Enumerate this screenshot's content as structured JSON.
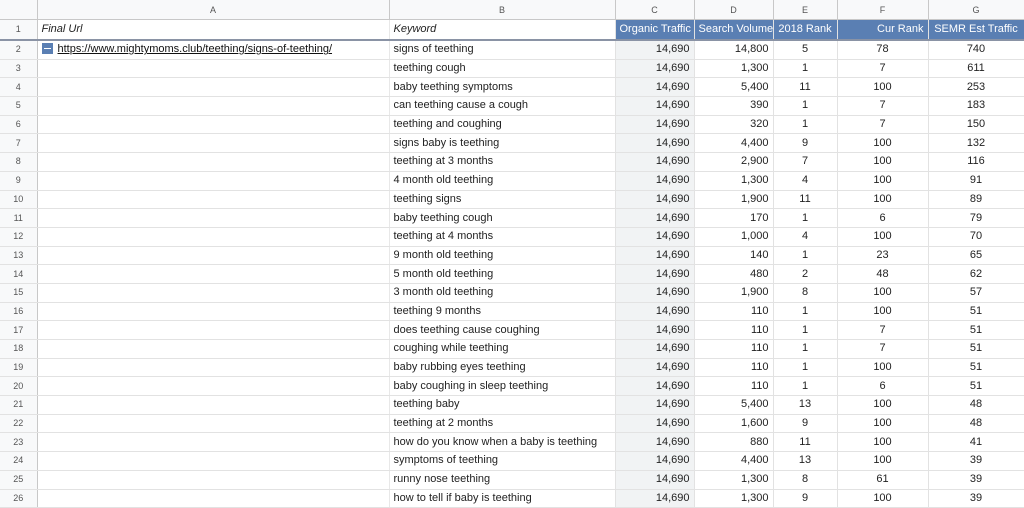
{
  "columns": [
    "A",
    "B",
    "C",
    "D",
    "E",
    "F",
    "G"
  ],
  "headers": {
    "final_url": "Final Url",
    "keyword": "Keyword",
    "organic_traffic": "Organic Traffic",
    "search_volume": "Search Volume",
    "rank_2018": "2018 Rank",
    "cur_rank": "Cur Rank",
    "semr_est_traffic": "SEMR Est Traffic"
  },
  "final_url": "https://www.mightymoms.club/teething/signs-of-teething/",
  "rows": [
    {
      "n": "2",
      "keyword": "signs of teething",
      "organic": "14,690",
      "volume": "14,800",
      "rank2018": "5",
      "cur": "78",
      "semr": "740"
    },
    {
      "n": "3",
      "keyword": "teething cough",
      "organic": "14,690",
      "volume": "1,300",
      "rank2018": "1",
      "cur": "7",
      "semr": "611"
    },
    {
      "n": "4",
      "keyword": "baby teething symptoms",
      "organic": "14,690",
      "volume": "5,400",
      "rank2018": "11",
      "cur": "100",
      "semr": "253"
    },
    {
      "n": "5",
      "keyword": "can teething cause a cough",
      "organic": "14,690",
      "volume": "390",
      "rank2018": "1",
      "cur": "7",
      "semr": "183"
    },
    {
      "n": "6",
      "keyword": "teething and coughing",
      "organic": "14,690",
      "volume": "320",
      "rank2018": "1",
      "cur": "7",
      "semr": "150"
    },
    {
      "n": "7",
      "keyword": "signs baby is teething",
      "organic": "14,690",
      "volume": "4,400",
      "rank2018": "9",
      "cur": "100",
      "semr": "132"
    },
    {
      "n": "8",
      "keyword": "teething at 3 months",
      "organic": "14,690",
      "volume": "2,900",
      "rank2018": "7",
      "cur": "100",
      "semr": "116"
    },
    {
      "n": "9",
      "keyword": "4 month old teething",
      "organic": "14,690",
      "volume": "1,300",
      "rank2018": "4",
      "cur": "100",
      "semr": "91"
    },
    {
      "n": "10",
      "keyword": "teething signs",
      "organic": "14,690",
      "volume": "1,900",
      "rank2018": "11",
      "cur": "100",
      "semr": "89"
    },
    {
      "n": "11",
      "keyword": "baby teething cough",
      "organic": "14,690",
      "volume": "170",
      "rank2018": "1",
      "cur": "6",
      "semr": "79"
    },
    {
      "n": "12",
      "keyword": "teething at 4 months",
      "organic": "14,690",
      "volume": "1,000",
      "rank2018": "4",
      "cur": "100",
      "semr": "70"
    },
    {
      "n": "13",
      "keyword": "9 month old teething",
      "organic": "14,690",
      "volume": "140",
      "rank2018": "1",
      "cur": "23",
      "semr": "65"
    },
    {
      "n": "14",
      "keyword": "5 month old teething",
      "organic": "14,690",
      "volume": "480",
      "rank2018": "2",
      "cur": "48",
      "semr": "62"
    },
    {
      "n": "15",
      "keyword": "3 month old teething",
      "organic": "14,690",
      "volume": "1,900",
      "rank2018": "8",
      "cur": "100",
      "semr": "57"
    },
    {
      "n": "16",
      "keyword": "teething 9 months",
      "organic": "14,690",
      "volume": "110",
      "rank2018": "1",
      "cur": "100",
      "semr": "51"
    },
    {
      "n": "17",
      "keyword": "does teething cause coughing",
      "organic": "14,690",
      "volume": "110",
      "rank2018": "1",
      "cur": "7",
      "semr": "51"
    },
    {
      "n": "18",
      "keyword": "coughing while teething",
      "organic": "14,690",
      "volume": "110",
      "rank2018": "1",
      "cur": "7",
      "semr": "51"
    },
    {
      "n": "19",
      "keyword": "baby rubbing eyes teething",
      "organic": "14,690",
      "volume": "110",
      "rank2018": "1",
      "cur": "100",
      "semr": "51"
    },
    {
      "n": "20",
      "keyword": "baby coughing in sleep teething",
      "organic": "14,690",
      "volume": "110",
      "rank2018": "1",
      "cur": "6",
      "semr": "51"
    },
    {
      "n": "21",
      "keyword": "teething baby",
      "organic": "14,690",
      "volume": "5,400",
      "rank2018": "13",
      "cur": "100",
      "semr": "48"
    },
    {
      "n": "22",
      "keyword": "teething at 2 months",
      "organic": "14,690",
      "volume": "1,600",
      "rank2018": "9",
      "cur": "100",
      "semr": "48"
    },
    {
      "n": "23",
      "keyword": "how do you know when a baby is teething",
      "organic": "14,690",
      "volume": "880",
      "rank2018": "11",
      "cur": "100",
      "semr": "41"
    },
    {
      "n": "24",
      "keyword": "symptoms of teething",
      "organic": "14,690",
      "volume": "4,400",
      "rank2018": "13",
      "cur": "100",
      "semr": "39"
    },
    {
      "n": "25",
      "keyword": "runny nose teething",
      "organic": "14,690",
      "volume": "1,300",
      "rank2018": "8",
      "cur": "61",
      "semr": "39"
    },
    {
      "n": "26",
      "keyword": "how to tell if baby is teething",
      "organic": "14,690",
      "volume": "1,300",
      "rank2018": "9",
      "cur": "100",
      "semr": "39"
    }
  ],
  "header_row_number": "1",
  "colors": {
    "header_blue": "#5a7fb3",
    "gridline": "#e2e2e2"
  },
  "icons": {
    "group_toggle": "minus-square-icon"
  }
}
